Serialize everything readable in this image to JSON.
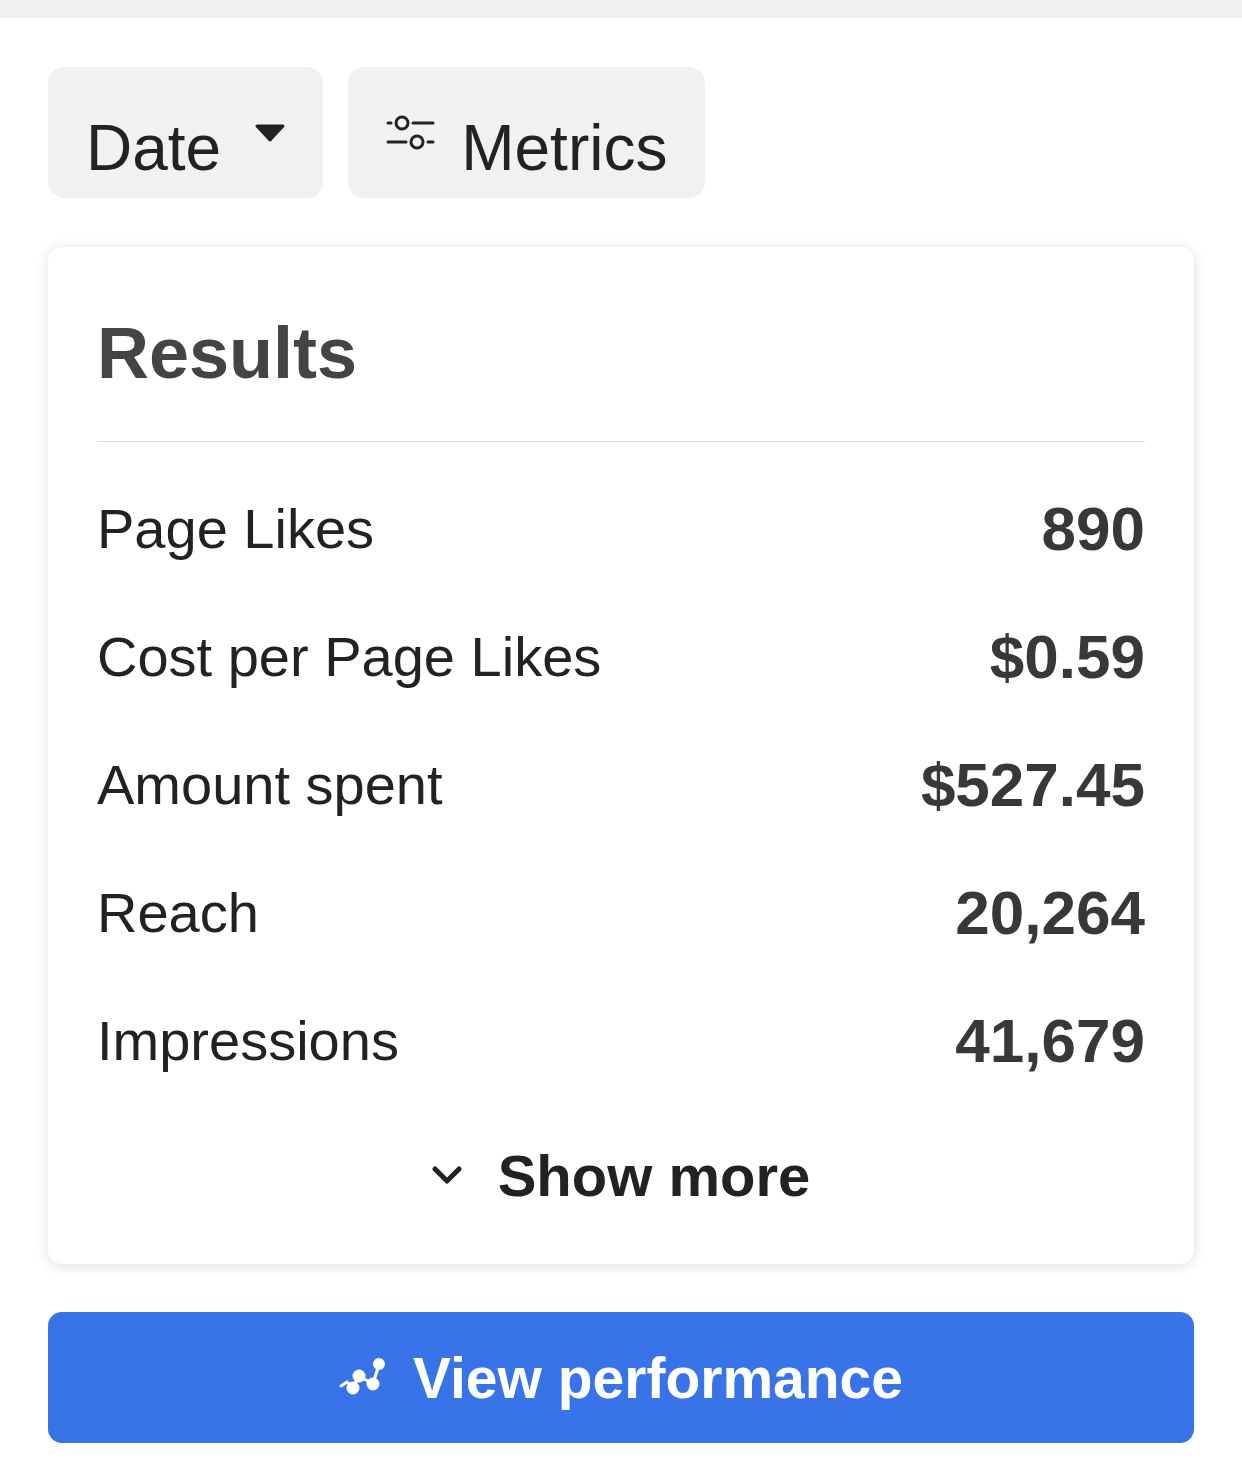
{
  "filters": [
    {
      "kind": "dropdown",
      "label": "Date"
    },
    {
      "kind": "settings",
      "label": "Metrics"
    }
  ],
  "results": {
    "title": "Results",
    "rows": [
      {
        "label": "Page Likes",
        "value": "890"
      },
      {
        "label": "Cost per Page Likes",
        "value": "$0.59"
      },
      {
        "label": "Amount spent",
        "value": "$527.45"
      },
      {
        "label": "Reach",
        "value": "20,264"
      },
      {
        "label": "Impressions",
        "value": "41,679"
      }
    ],
    "show_more": "Show more"
  },
  "action_button": {
    "label": "View performance"
  }
}
